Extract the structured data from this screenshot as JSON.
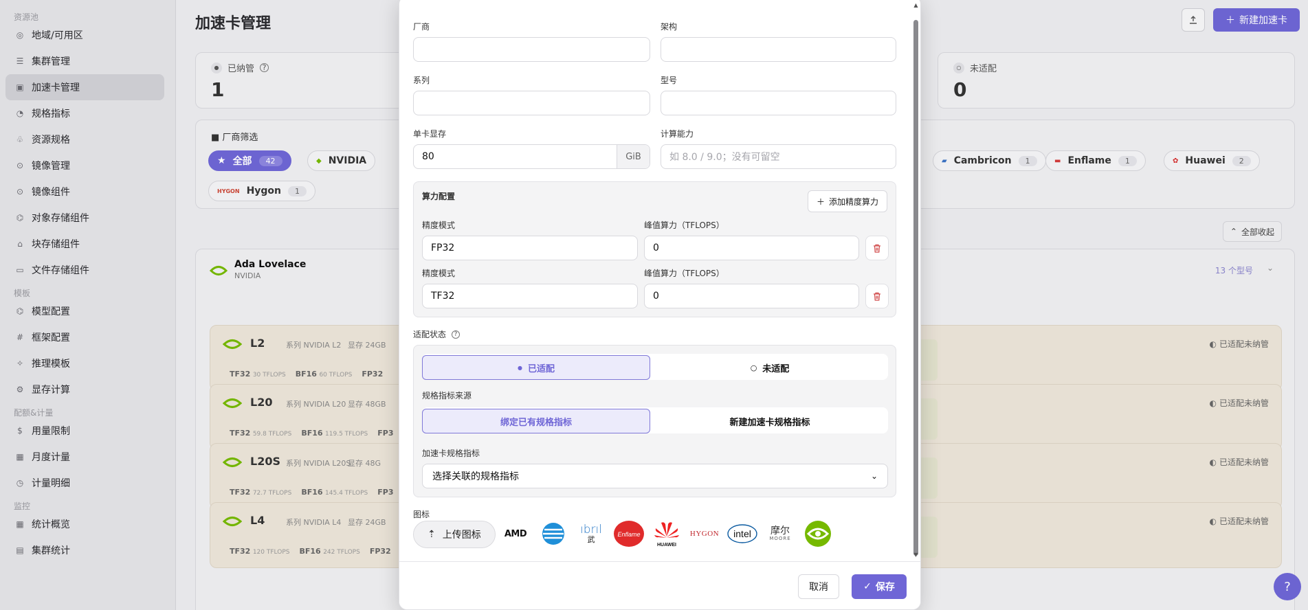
{
  "sidebar": {
    "sections": [
      {
        "title": "资源池",
        "items": [
          "地域/可用区",
          "集群管理",
          "加速卡管理",
          "规格指标",
          "资源规格",
          "镜像管理",
          "镜像组件",
          "对象存储组件",
          "块存储组件",
          "文件存储组件"
        ]
      },
      {
        "title": "模板",
        "items": [
          "模型配置",
          "框架配置",
          "推理模板",
          "显存计算"
        ]
      },
      {
        "title": "配额&计量",
        "items": [
          "用量限制",
          "月度计量",
          "计量明细"
        ]
      },
      {
        "title": "监控",
        "items": [
          "统计概览",
          "集群统计"
        ]
      }
    ],
    "active": "加速卡管理"
  },
  "page": {
    "title": "加速卡管理",
    "new_button": "新建加速卡",
    "stats": [
      {
        "label": "已纳管",
        "value": "1"
      },
      {
        "label": "未适配",
        "value": "0"
      }
    ],
    "filter": {
      "title": "厂商筛选",
      "chips": [
        {
          "name": "全部",
          "count": "42"
        },
        {
          "name": "NVIDIA",
          "count": ""
        },
        {
          "name": "Cambricon",
          "count": "1"
        },
        {
          "name": "Enflame",
          "count": "1"
        },
        {
          "name": "Huawei",
          "count": "2"
        },
        {
          "name": "Hygon",
          "count": "1"
        }
      ]
    },
    "collapse_all": "全部收起",
    "group": {
      "title": "Ada Lovelace",
      "vendor": "NVIDIA",
      "count": "13 个型号"
    },
    "models": [
      {
        "name": "L2",
        "series": "系列 NVIDIA L2",
        "mem": "显存 24GB",
        "specs": [
          [
            "TF32",
            "30 TFLOPS"
          ],
          [
            "BF16",
            "60 TFLOPS"
          ],
          [
            "FP32",
            ""
          ]
        ],
        "status": "已适配未纳管"
      },
      {
        "name": "L20",
        "series": "系列 NVIDIA L20",
        "mem": "显存 48GB",
        "specs": [
          [
            "TF32",
            "59.8 TFLOPS"
          ],
          [
            "BF16",
            "119.5 TFLOPS"
          ],
          [
            "FP3",
            ""
          ]
        ],
        "status": "已适配未纳管"
      },
      {
        "name": "L20S",
        "series": "系列 NVIDIA L20S",
        "mem": "显存 48G",
        "specs": [
          [
            "TF32",
            "72.7 TFLOPS"
          ],
          [
            "BF16",
            "145.4 TFLOPS"
          ],
          [
            "FP3",
            ""
          ]
        ],
        "status": "已适配未纳管"
      },
      {
        "name": "L4",
        "series": "系列 NVIDIA L4",
        "mem": "显存 24GB",
        "specs": [
          [
            "TF32",
            "120 TFLOPS"
          ],
          [
            "BF16",
            "242 TFLOPS"
          ],
          [
            "FP32",
            ""
          ]
        ],
        "status": "已适配未纳管"
      }
    ]
  },
  "modal": {
    "vendor_label": "厂商",
    "arch_label": "架构",
    "series_label": "系列",
    "model_label": "型号",
    "memory_label": "单卡显存",
    "memory_value": "80",
    "memory_unit": "GiB",
    "compute_label": "计算能力",
    "compute_placeholder": "如 8.0 / 9.0；没有可留空",
    "power_config_label": "算力配置",
    "add_precision_button": "添加精度算力",
    "precision_rows": [
      {
        "mode_label": "精度模式",
        "mode_value": "FP32",
        "peak_label": "峰值算力（TFLOPS）",
        "peak_value": "0"
      },
      {
        "mode_label": "精度模式",
        "mode_value": "TF32",
        "peak_label": "峰值算力（TFLOPS）",
        "peak_value": "0"
      }
    ],
    "adapt_status_label": "适配状态",
    "adapt_options": [
      "已适配",
      "未适配"
    ],
    "spec_source_label": "规格指标来源",
    "spec_source_options": [
      "绑定已有规格指标",
      "新建加速卡规格指标"
    ],
    "spec_label": "加速卡规格指标",
    "spec_select_value": "选择关联的规格指标",
    "icon_label": "图标",
    "upload_button": "上传图标",
    "icon_options": [
      "AMD",
      "Cambricon",
      "Iluvatar",
      "Enflame",
      "Huawei",
      "HYGON",
      "intel",
      "摩尔 MOORE",
      "NVIDIA"
    ],
    "cancel_button": "取消",
    "save_button": "保存"
  }
}
